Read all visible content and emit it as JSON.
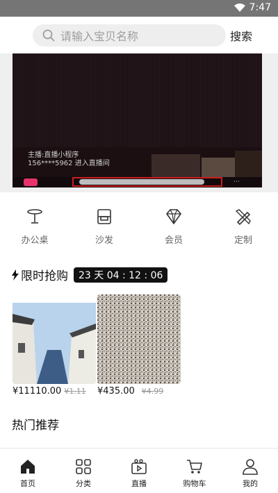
{
  "status_bar": {
    "time": "7:47",
    "wifi_icon": "wifi-icon"
  },
  "search": {
    "placeholder": "请输入宝贝名称",
    "button_label": "搜索"
  },
  "banner": {
    "caption_line1": "主播:直播小程序",
    "caption_line2": "156****5962 进入直播间"
  },
  "categories": [
    {
      "label": "办公桌",
      "icon": "desk-icon"
    },
    {
      "label": "沙发",
      "icon": "sofa-icon"
    },
    {
      "label": "会员",
      "icon": "diamond-icon"
    },
    {
      "label": "定制",
      "icon": "ruler-pencil-icon"
    }
  ],
  "flash_sale": {
    "title": "限时抢购",
    "countdown": "23 天 04 : 12 : 06",
    "products": [
      {
        "price": "¥11110.00",
        "old_price": "¥1.11"
      },
      {
        "price": "¥435.00",
        "old_price": "¥4.99"
      }
    ]
  },
  "hot": {
    "title": "热门推荐"
  },
  "tabbar": [
    {
      "label": "首页",
      "icon": "home-icon"
    },
    {
      "label": "分类",
      "icon": "grid-icon"
    },
    {
      "label": "直播",
      "icon": "live-video-icon"
    },
    {
      "label": "购物车",
      "icon": "cart-icon"
    },
    {
      "label": "我的",
      "icon": "user-icon"
    }
  ]
}
